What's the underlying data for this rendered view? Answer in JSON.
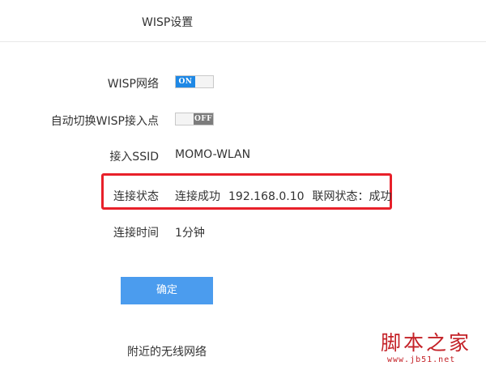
{
  "header": {
    "title": "WISP设置"
  },
  "form": {
    "wisp_network": {
      "label": "WISP网络",
      "toggle_text": "ON",
      "state": "on"
    },
    "auto_switch": {
      "label": "自动切换WISP接入点",
      "toggle_text": "OFF",
      "state": "off"
    },
    "ssid": {
      "label": "接入SSID",
      "value": "MOMO-WLAN"
    },
    "connection_status": {
      "label": "连接状态",
      "status": "连接成功",
      "ip": "192.168.0.10",
      "internet_status": "联网状态：成功"
    },
    "connection_time": {
      "label": "连接时间",
      "value": "1分钟"
    },
    "confirm_label": "确定"
  },
  "nearby": {
    "title": "附近的无线网络"
  },
  "watermark": {
    "text": "脚本之家",
    "url": "www.jb51.net"
  },
  "colors": {
    "accent": "#1e88e5",
    "button": "#4b9cee",
    "highlight": "#e8202a",
    "watermark": "#c42127",
    "text": "#333333"
  }
}
